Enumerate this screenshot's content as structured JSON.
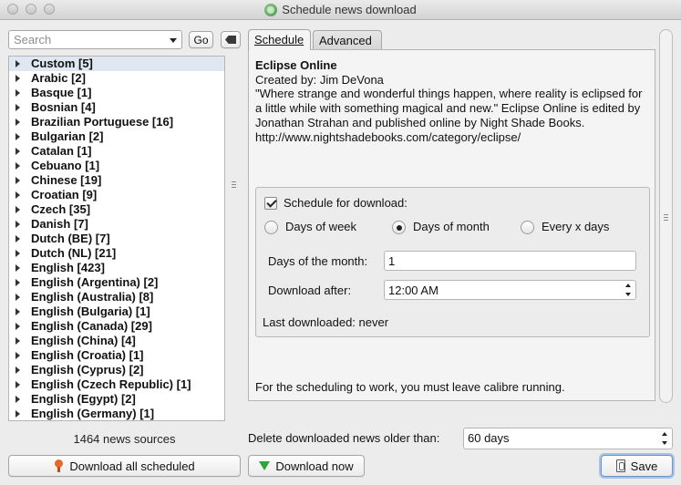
{
  "window": {
    "title": "Schedule news download"
  },
  "search": {
    "placeholder": "Search",
    "go_label": "Go"
  },
  "sources": {
    "count_text": "1464 news sources",
    "items": [
      "Custom [5]",
      "Arabic [2]",
      "Basque [1]",
      "Bosnian [4]",
      "Brazilian Portuguese [16]",
      "Bulgarian [2]",
      "Catalan [1]",
      "Cebuano [1]",
      "Chinese [19]",
      "Croatian [9]",
      "Czech [35]",
      "Danish [7]",
      "Dutch (BE) [7]",
      "Dutch (NL) [21]",
      "English [423]",
      "English (Argentina) [2]",
      "English (Australia) [8]",
      "English (Bulgaria) [1]",
      "English (Canada) [29]",
      "English (China) [4]",
      "English (Croatia) [1]",
      "English (Cyprus) [2]",
      "English (Czech Republic) [1]",
      "English (Egypt) [2]",
      "English (Germany) [1]"
    ],
    "selected_index": 0
  },
  "tabs": {
    "schedule": "Schedule",
    "advanced": "Advanced",
    "active": "schedule"
  },
  "source": {
    "title": "Eclipse Online",
    "author": "Created by: Jim DeVona",
    "description": "\"Where strange and wonderful things happen, where reality is eclipsed for a little while with something magical and new.\" Eclipse Online is edited by Jonathan Strahan and published online by Night Shade Books. http://www.nightshadebooks.com/category/eclipse/"
  },
  "schedule": {
    "checkbox_label": "Schedule for download:",
    "checked": true,
    "options": [
      "Days of  week",
      "Days of month",
      "Every x days"
    ],
    "selected_option": 1,
    "days_label": "Days of the month:",
    "days_value": "1",
    "after_label": "Download after:",
    "after_value": "12:00 AM",
    "last_downloaded": "Last downloaded: never"
  },
  "note": "For the scheduling to work, you must leave calibre running.",
  "delete": {
    "label": "Delete downloaded news older than:",
    "value": "60 days"
  },
  "buttons": {
    "download_all": "Download all scheduled",
    "download_now": "Download now",
    "save": "Save"
  }
}
